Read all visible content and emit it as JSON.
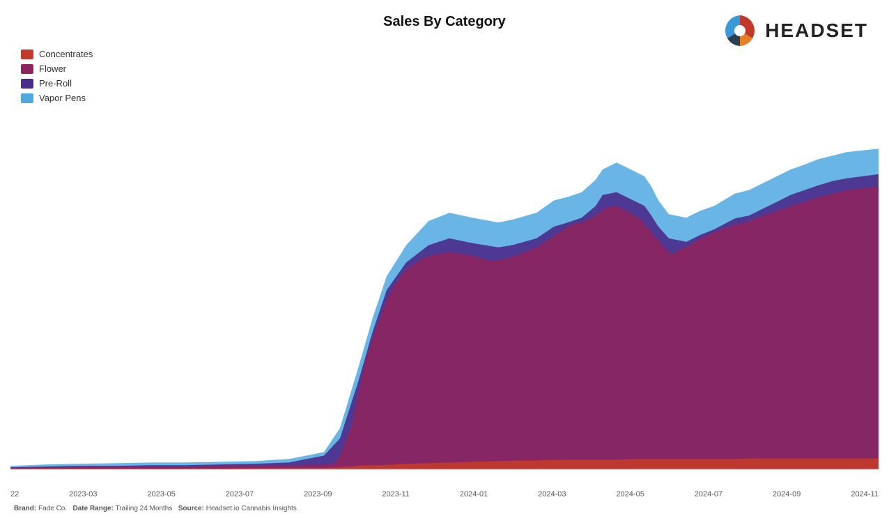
{
  "page": {
    "title": "Sales By Category"
  },
  "logo": {
    "text": "HEADSET"
  },
  "legend": {
    "items": [
      {
        "id": "concentrates",
        "label": "Concentrates",
        "color": "#c0392b"
      },
      {
        "id": "flower",
        "label": "Flower",
        "color": "#8e2560"
      },
      {
        "id": "preroll",
        "label": "Pre-Roll",
        "color": "#4a2a8a"
      },
      {
        "id": "vaporpens",
        "label": "Vapor Pens",
        "color": "#3a9ad9"
      }
    ]
  },
  "xaxis": {
    "labels": [
      "22",
      "2023-03",
      "2023-05",
      "2023-07",
      "2023-09",
      "2023-11",
      "2024-01",
      "2024-03",
      "2024-05",
      "2024-07",
      "2024-09",
      "2024-11"
    ]
  },
  "footer": {
    "brand_label": "Brand:",
    "brand_value": "Fade Co.",
    "daterange_label": "Date Range:",
    "daterange_value": "Trailing 24 Months",
    "source_label": "Source:",
    "source_value": "Headset.io Cannabis Insights"
  },
  "colors": {
    "concentrates": "#c0392b",
    "flower": "#8e2560",
    "preroll": "#4a2a8a",
    "vaporpens": "#4fa8e0",
    "background": "#ffffff"
  }
}
